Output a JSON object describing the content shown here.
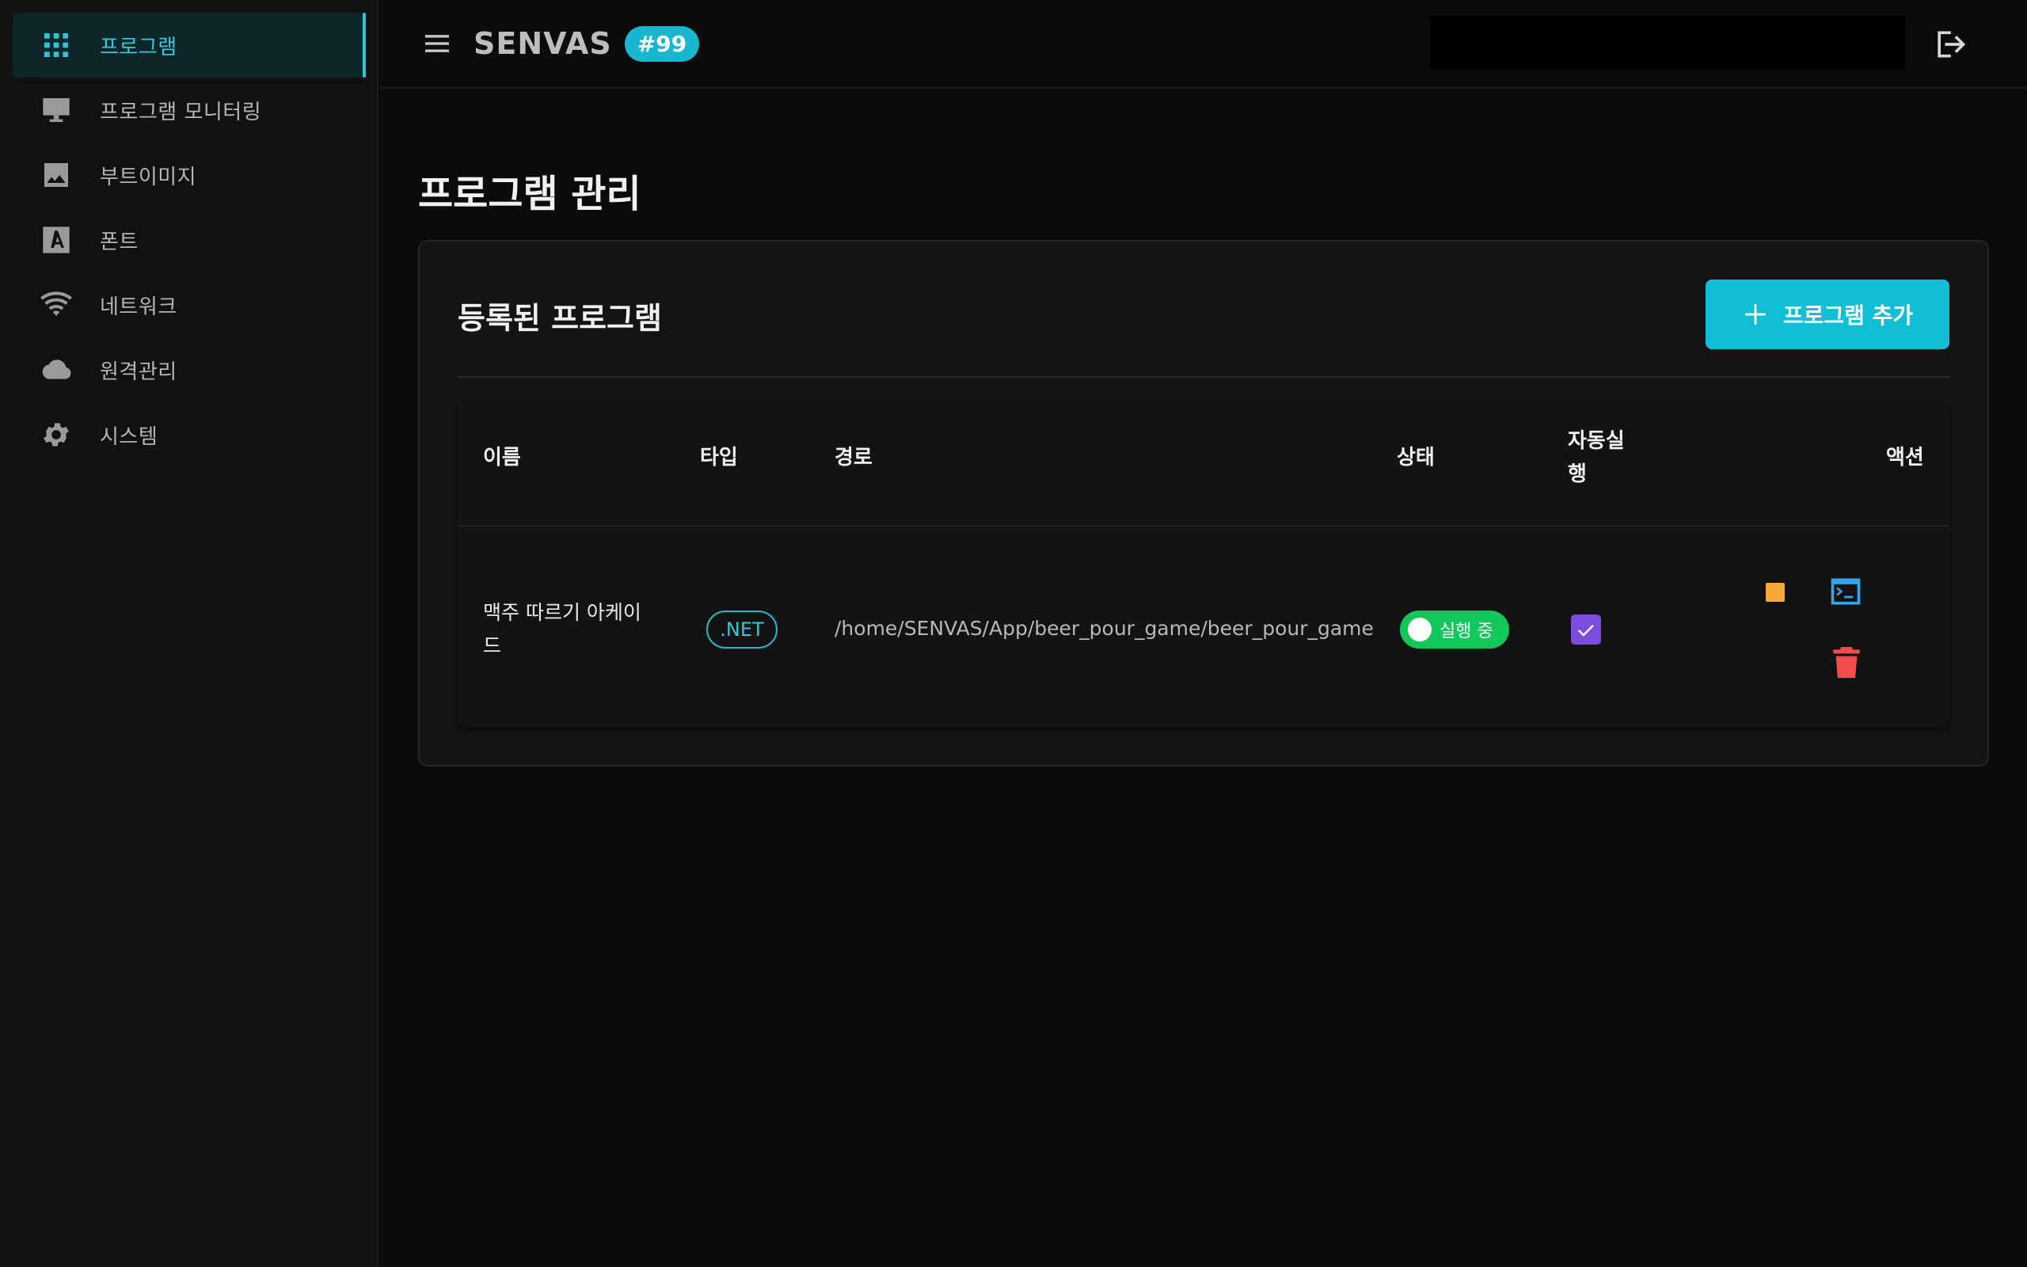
{
  "sidebar": {
    "items": [
      {
        "label": "프로그램",
        "icon": "grid-icon",
        "active": true
      },
      {
        "label": "프로그램 모니터링",
        "icon": "monitor-icon",
        "active": false
      },
      {
        "label": "부트이미지",
        "icon": "image-icon",
        "active": false
      },
      {
        "label": "폰트",
        "icon": "font-icon",
        "active": false
      },
      {
        "label": "네트워크",
        "icon": "wifi-icon",
        "active": false
      },
      {
        "label": "원격관리",
        "icon": "cloud-icon",
        "active": false
      },
      {
        "label": "시스템",
        "icon": "gear-icon",
        "active": false
      }
    ]
  },
  "header": {
    "brand": "SENVAS",
    "badge": "#99"
  },
  "main": {
    "page_title": "프로그램 관리",
    "card_title": "등록된 프로그램",
    "add_button_label": "프로그램 추가",
    "table": {
      "columns": [
        "이름",
        "타입",
        "경로",
        "상태",
        "자동실\n행",
        "액션"
      ],
      "rows": [
        {
          "name": "맥주 따르기 아케이\n드",
          "type": ".NET",
          "path": "/home/SENVAS/App/beer_pour_game/beer_pour_game",
          "status": "실행 중",
          "autorun": true
        }
      ]
    }
  },
  "colors": {
    "accent": "#12bdd6",
    "status_running": "#12c85c",
    "checkbox": "#7c4ddb",
    "stop": "#f7a63a",
    "terminal": "#36a4e6",
    "delete": "#f24c4c"
  }
}
